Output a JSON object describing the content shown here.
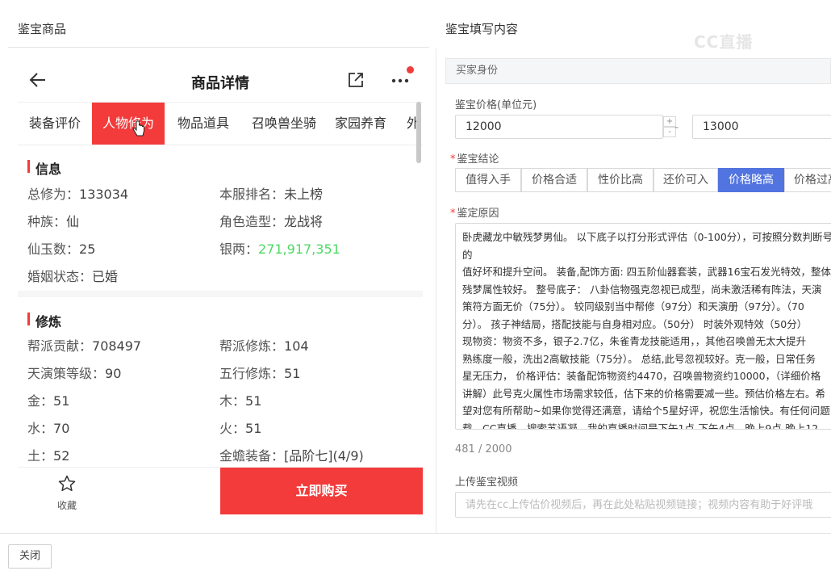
{
  "left_section_title": "鉴宝商品",
  "right_section_title": "鉴宝填写内容",
  "watermark": "CC直播",
  "phone": {
    "title": "商品详情",
    "tabs": [
      "装备评价",
      "人物修为",
      "物品道具",
      "召唤兽坐骑",
      "家园养育",
      "外"
    ],
    "active_tab": "人物修为",
    "info": {
      "heading": "信息",
      "rows": [
        {
          "label": "总修为：",
          "value": "133034"
        },
        {
          "label": "本服排名：",
          "value": "未上榜"
        },
        {
          "label": "种族：",
          "value": "仙"
        },
        {
          "label": "角色造型：",
          "value": "龙战将"
        },
        {
          "label": "仙玉数：",
          "value": "25"
        },
        {
          "label": "银两：",
          "value": "271,917,351"
        },
        {
          "label": "婚姻状态：",
          "value": "已婚"
        }
      ]
    },
    "cultivation": {
      "heading": "修炼",
      "rows": [
        {
          "label": "帮派贡献：",
          "value": "708497"
        },
        {
          "label": "帮派修炼：",
          "value": "104"
        },
        {
          "label": "天演策等级：",
          "value": "90"
        },
        {
          "label": "五行修炼：",
          "value": "51"
        },
        {
          "label": "金：",
          "value": "51"
        },
        {
          "label": "木：",
          "value": "51"
        },
        {
          "label": "水：",
          "value": "70"
        },
        {
          "label": "火：",
          "value": "51"
        },
        {
          "label": "土：",
          "value": "52"
        },
        {
          "label": "金蟾装备：",
          "value": "[品阶七](4/9)"
        }
      ]
    },
    "favorite_label": "收藏",
    "buy_label": "立即购买",
    "silver_color": "#4cd964",
    "accent": "#f33b3b"
  },
  "form": {
    "header": "买家身份",
    "price_label": "鉴宝价格(单位元)",
    "price_min": "12000",
    "price_max": "13000",
    "price_separator": "-",
    "stepper_up": "+",
    "stepper_down": "-",
    "conclusion_label": "鉴宝结论",
    "conclusions": [
      "值得入手",
      "价格合适",
      "性价比高",
      "还价可入",
      "价格略高",
      "价格过高"
    ],
    "active_conclusion": "价格略高",
    "reason_label": "鉴定原因",
    "reason_text": "卧虎藏龙中敏残梦男仙。 以下底子以打分形式评估（0-100分），可按照分数判断号的\n值好坏和提升空间。 装备,配饰方面: 四五阶仙器套装，武器16宝石发光特效，整体\n残梦属性较好。 整号底子： 八卦信物强克忽视已成型，尚未激活稀有阵法，天演\n策符方面无价（75分）。 较同级别当中帮修（97分）和天演册（97分）。（70\n分）。 孩子神结局，搭配技能与自身相对应。（50分） 时装外观特效（50分）\n现物资：物资不多，银子2.7亿，朱雀青龙技能适用，，其他召唤兽无太大提升\n熟练度一般，洗出2高敏技能（75分）。 总结,此号忽视较好。克一般，日常任务\n星无压力， 价格评估：装备配饰物资约4470，召唤兽物资约10000，（详细价格\n讲解）此号克火属性市场需求较低，估下来的价格需要减一些。预估价格左右。希\n望对您有所帮助~如果你觉得还满意，请给个5星好评，祝您生活愉快。有任何问题\n载，CC直播，搜索苏语凝，我的直播时间是下午1点-下午4点。晚上9点-晚上12点，\n么游戏问题都可以咨询哦，有疑问来直播间解了答，再给好评哦。",
    "count_text": "481 / 2000",
    "video_label": "上传鉴宝视频",
    "video_placeholder": "请先在cc上传估价视频后，再在此处粘贴视频链接；视频内容有助于好评哦",
    "active_color": "#5274e0"
  },
  "close_label": "关闭"
}
